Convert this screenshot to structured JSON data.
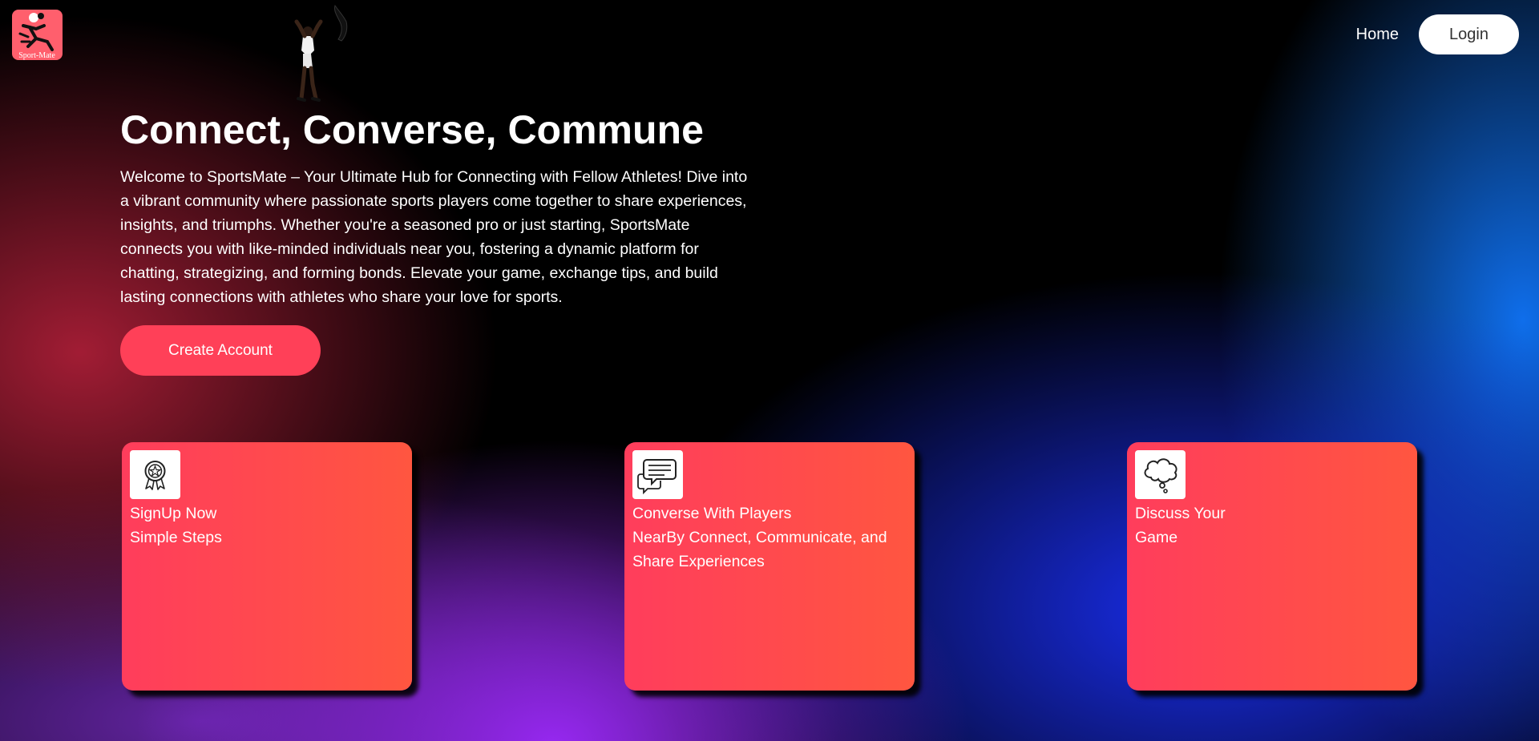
{
  "header": {
    "logo_text": "Sport-Mate",
    "nav": {
      "home_label": "Home",
      "login_label": "Login"
    }
  },
  "hero": {
    "title": "Connect, Converse, Commune",
    "description": "Welcome to SportsMate – Your Ultimate Hub for Connecting with Fellow Athletes! Dive into a vibrant community where passionate sports players come together to share experiences, insights, and triumphs. Whether you're a seasoned pro or just starting, SportsMate connects you with like-minded individuals near you, fostering a dynamic platform for chatting, strategizing, and forming bonds. Elevate your game, exchange tips, and build lasting connections with athletes who share your love for sports.",
    "cta_label": "Create Account"
  },
  "cards": [
    {
      "icon": "award-ribbon-icon",
      "title": "SignUp Now",
      "subtitle": "Simple Steps"
    },
    {
      "icon": "chat-bubbles-icon",
      "title": "Converse With Players",
      "subtitle": "NearBy Connect, Communicate, and Share Experiences"
    },
    {
      "icon": "thought-cloud-icon",
      "title": "Discuss Your",
      "subtitle": "Game"
    }
  ],
  "colors": {
    "accent": "#ff4058",
    "card_gradient_start": "#ff3d5c",
    "card_gradient_end": "#ff5640",
    "login_button_bg": "#ffffff"
  }
}
